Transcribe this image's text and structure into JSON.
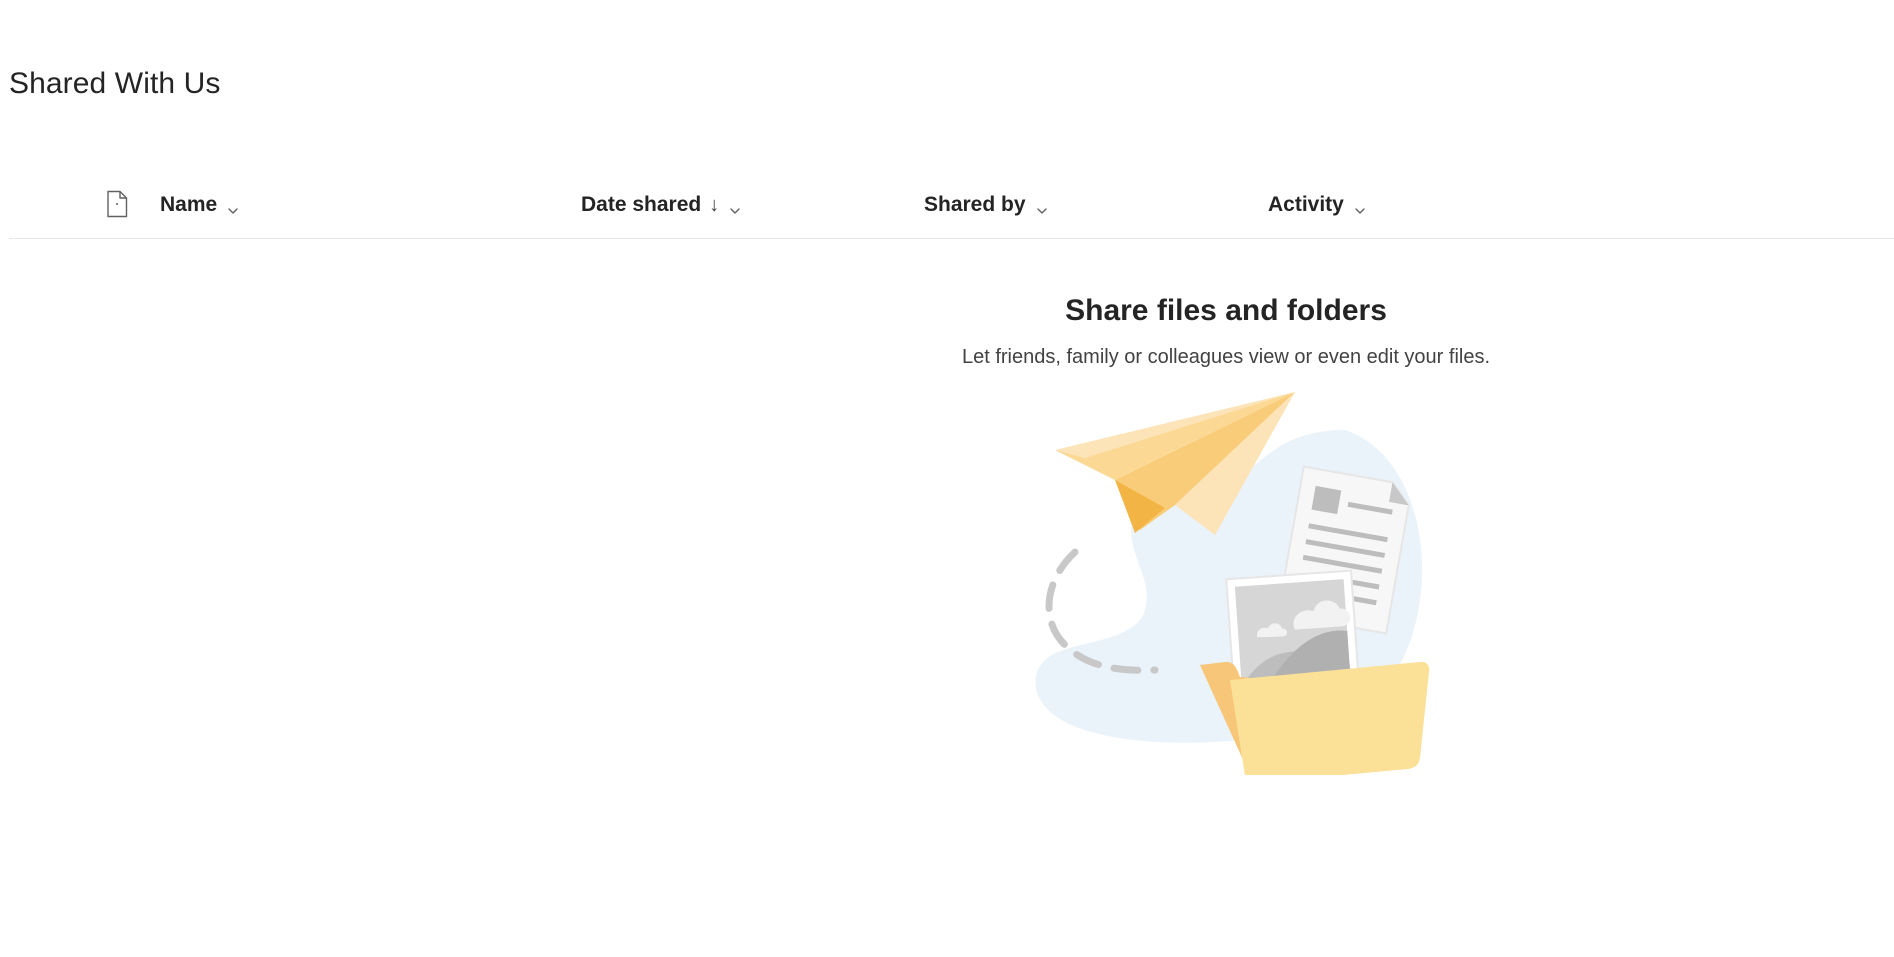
{
  "page": {
    "title": "Shared With Us"
  },
  "columns": {
    "file_type_icon": "file-icon",
    "name": "Name",
    "date_shared": "Date shared",
    "date_shared_sort": "↓",
    "shared_by": "Shared by",
    "activity": "Activity"
  },
  "empty_state": {
    "title": "Share files and folders",
    "subtitle": "Let friends, family or colleagues view or even edit your files.",
    "illustration": "paper-plane-folder-illustration"
  },
  "colors": {
    "text_primary": "#242424",
    "text_secondary": "#424242",
    "divider": "#e6e6e6",
    "blob": "#eaf2fa",
    "plane_light": "#fce4b8",
    "plane_mid": "#f9cc7a",
    "plane_dark": "#f2b545",
    "folder_front": "#fbe198",
    "folder_back": "#f7c678"
  }
}
